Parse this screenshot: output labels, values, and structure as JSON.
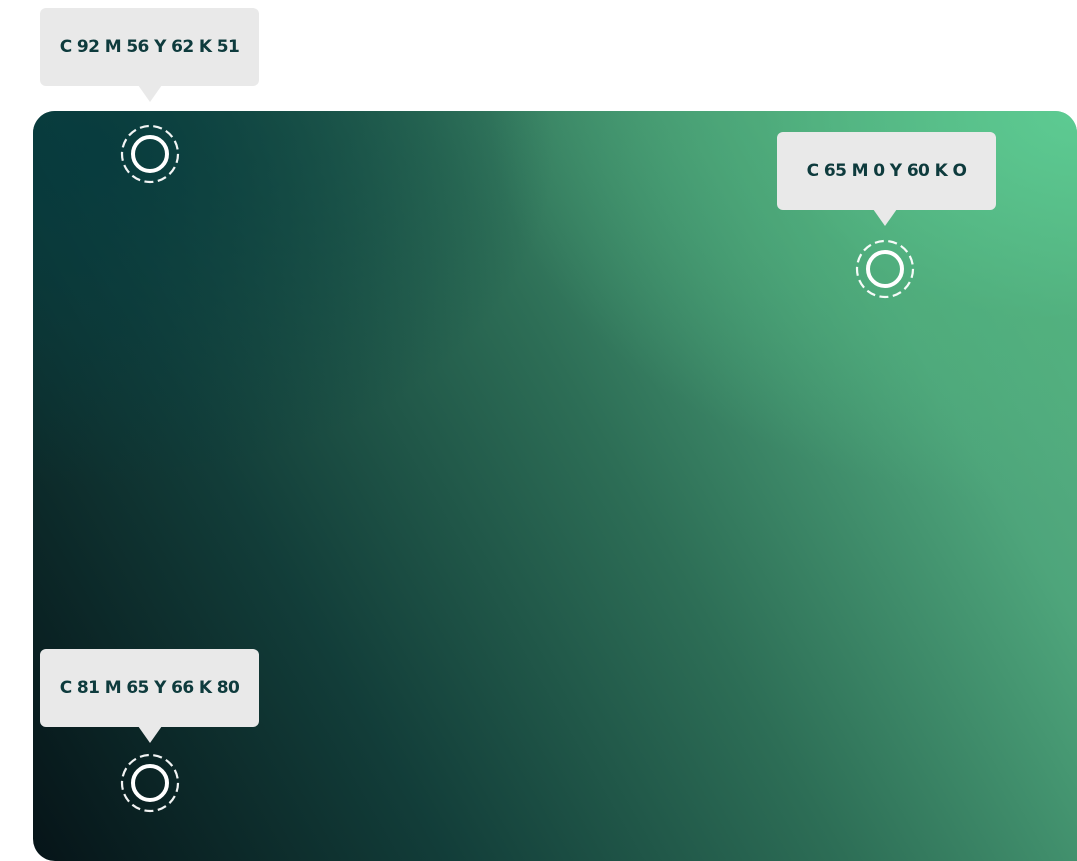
{
  "colors": {
    "tooltip_background": "#e9e9e9",
    "tooltip_text": "#0e3b3d",
    "gradient_dark": "#061418",
    "gradient_mid": "#2d6e56",
    "gradient_light": "#5dcc93",
    "marker_ring": "#ffffff"
  },
  "color_stops": [
    {
      "label": "C 92 M 56 Y 62 K 51",
      "icon": "color-picker-ring-icon"
    },
    {
      "label": "C 65 M 0 Y 60 K O",
      "icon": "color-picker-ring-icon"
    },
    {
      "label": "C 81 M 65 Y 66 K 80",
      "icon": "color-picker-ring-icon"
    }
  ]
}
